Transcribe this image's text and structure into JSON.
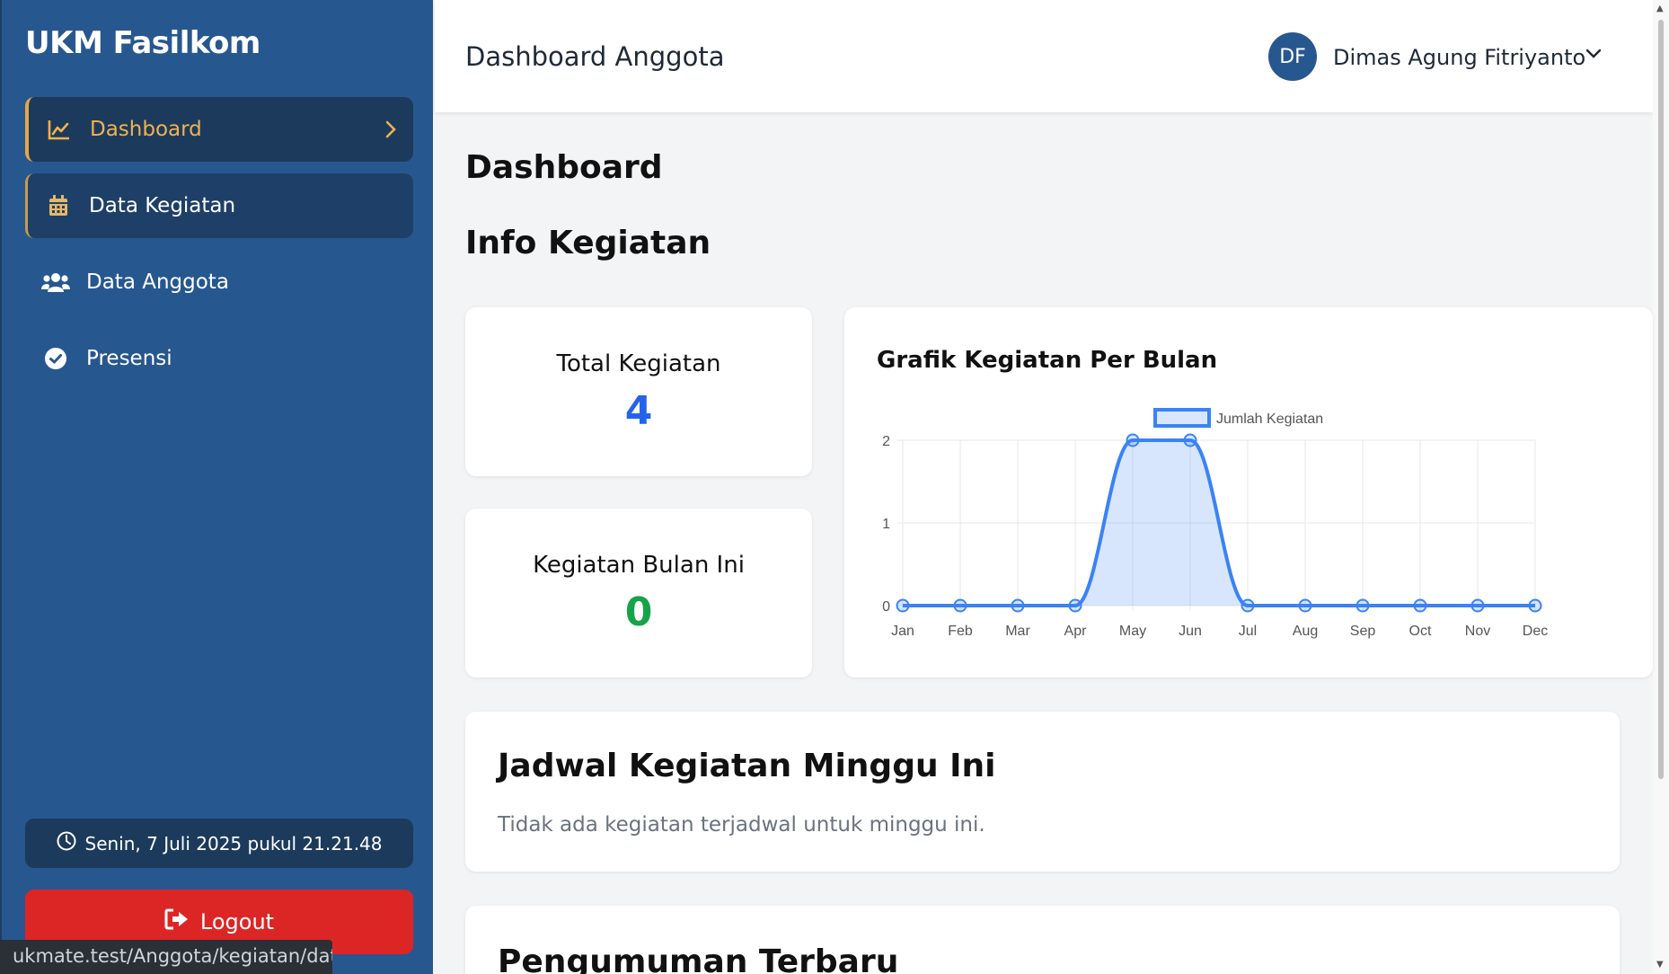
{
  "sidebar": {
    "brand": "UKM Fasilkom",
    "items": [
      {
        "label": "Dashboard",
        "icon": "chart-line-icon"
      },
      {
        "label": "Data Kegiatan",
        "icon": "calendar-icon"
      },
      {
        "label": "Data Anggota",
        "icon": "users-icon"
      },
      {
        "label": "Presensi",
        "icon": "check-circle-icon"
      }
    ],
    "datetime": "Senin, 7 Juli 2025 pukul 21.21.48",
    "logout_label": "Logout"
  },
  "status_url": "ukmate.test/Anggota/kegiatan/data-ke",
  "header": {
    "title": "Dashboard Anggota",
    "avatar_initials": "DF",
    "user_name": "Dimas Agung Fitriyanto"
  },
  "main": {
    "page_title": "Dashboard",
    "section_title": "Info Kegiatan",
    "stats": [
      {
        "label": "Total Kegiatan",
        "value": "4",
        "color": "#2563eb"
      },
      {
        "label": "Kegiatan Bulan Ini",
        "value": "0",
        "color": "#16a34a"
      }
    ],
    "chart_title": "Grafik Kegiatan Per Bulan",
    "jadwal_title": "Jadwal Kegiatan Minggu Ini",
    "jadwal_empty": "Tidak ada kegiatan terjadwal untuk minggu ini.",
    "pengumuman_title": "Pengumuman Terbaru"
  },
  "chart_data": {
    "type": "line",
    "title": "Grafik Kegiatan Per Bulan",
    "categories": [
      "Jan",
      "Feb",
      "Mar",
      "Apr",
      "May",
      "Jun",
      "Jul",
      "Aug",
      "Sep",
      "Oct",
      "Nov",
      "Dec"
    ],
    "series": [
      {
        "name": "Jumlah Kegiatan",
        "values": [
          0,
          0,
          0,
          0,
          2,
          2,
          0,
          0,
          0,
          0,
          0,
          0
        ],
        "color": "#3b82f6"
      }
    ],
    "yticks": [
      "0",
      "1",
      "2"
    ],
    "ylim": [
      0,
      2
    ],
    "fill": true,
    "grid": true,
    "legend": "top-center"
  }
}
